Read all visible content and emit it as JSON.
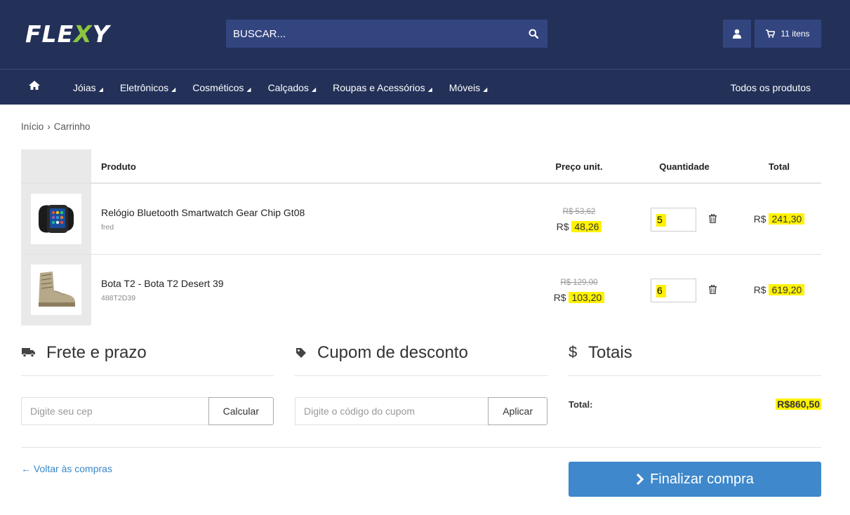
{
  "header": {
    "logo": {
      "part1": "FLE",
      "part2": "X",
      "part3": "Y"
    },
    "search_placeholder": "BUSCAR...",
    "cart_count": "11 itens"
  },
  "nav": {
    "items": [
      "Jóias",
      "Eletrônicos",
      "Cosméticos",
      "Calçados",
      "Roupas e Acessórios",
      "Móveis"
    ],
    "all_products": "Todos os produtos"
  },
  "breadcrumb": {
    "home": "Início",
    "sep": "›",
    "current": "Carrinho"
  },
  "table": {
    "headers": {
      "product": "Produto",
      "unit_price": "Preço unit.",
      "quantity": "Quantidade",
      "total": "Total"
    },
    "rows": [
      {
        "name": "Relógio Bluetooth Smartwatch Gear Chip Gt08",
        "sku": "fred",
        "old_price": "R$ 53,62",
        "currency": "R$",
        "price": "48,26",
        "qty": "5",
        "total": "241,30"
      },
      {
        "name": "Bota T2 - Bota T2 Desert 39",
        "sku": "488T2D39",
        "old_price": "R$ 129,00",
        "currency": "R$",
        "price": "103,20",
        "qty": "6",
        "total": "619,20"
      }
    ]
  },
  "shipping": {
    "title": "Frete e prazo",
    "placeholder": "Digite seu cep",
    "button": "Calcular"
  },
  "coupon": {
    "title": "Cupom de desconto",
    "placeholder": "Digite o código do cupom",
    "button": "Aplicar"
  },
  "totals": {
    "title": "Totais",
    "symbol": "$",
    "label": "Total:",
    "value": "R$860,50"
  },
  "footer": {
    "back": "← Voltar às compras",
    "checkout": "Finalizar compra"
  },
  "colors": {
    "header_bg": "#233159",
    "search_bg": "#33457f",
    "highlight": "#fff200",
    "checkout_bg": "#3f88cb",
    "link": "#3a87c8"
  }
}
